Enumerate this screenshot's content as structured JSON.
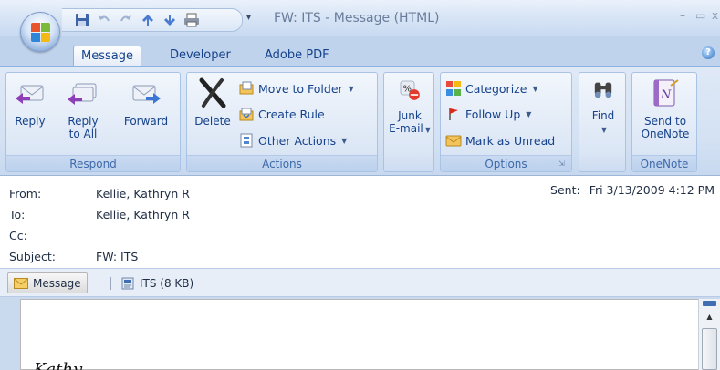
{
  "window": {
    "title": "FW: ITS - Message (HTML)",
    "minimize": "–",
    "maximize": "▭",
    "close": "x"
  },
  "quick_access": {
    "items": [
      "save-icon",
      "undo-icon",
      "redo-icon",
      "previous-item-icon",
      "next-item-icon",
      "print-icon"
    ],
    "customize": "▾"
  },
  "tabs": [
    "Message",
    "Developer",
    "Adobe PDF"
  ],
  "help": "?",
  "ribbon": {
    "respond": {
      "label": "Respond",
      "reply": "Reply",
      "reply_all_1": "Reply",
      "reply_all_2": "to All",
      "forward": "Forward"
    },
    "actions": {
      "label": "Actions",
      "delete": "Delete",
      "move_to_folder": "Move to Folder",
      "create_rule": "Create Rule",
      "other_actions": "Other Actions"
    },
    "junk": {
      "line1": "Junk",
      "line2": "E-mail"
    },
    "options": {
      "label": "Options",
      "categorize": "Categorize",
      "follow_up": "Follow Up",
      "mark_unread": "Mark as Unread"
    },
    "find": {
      "label": "Find"
    },
    "onenote": {
      "label": "OneNote",
      "send_1": "Send to",
      "send_2": "OneNote"
    }
  },
  "header": {
    "from_label": "From:",
    "from": "Kellie, Kathryn R",
    "to_label": "To:",
    "to": "Kellie, Kathryn R",
    "cc_label": "Cc:",
    "cc": "",
    "subject_label": "Subject:",
    "subject": "FW: ITS",
    "sent_label": "Sent:",
    "sent": "Fri 3/13/2009 4:12 PM"
  },
  "attachments": {
    "message": "Message",
    "file": "ITS (8 KB)"
  },
  "body": {
    "greeting": "Kathy"
  },
  "colors": {
    "ribbon_text": "#15428b",
    "ribbon_bg": "#d3e1f3",
    "header_text": "#1f2d44"
  }
}
